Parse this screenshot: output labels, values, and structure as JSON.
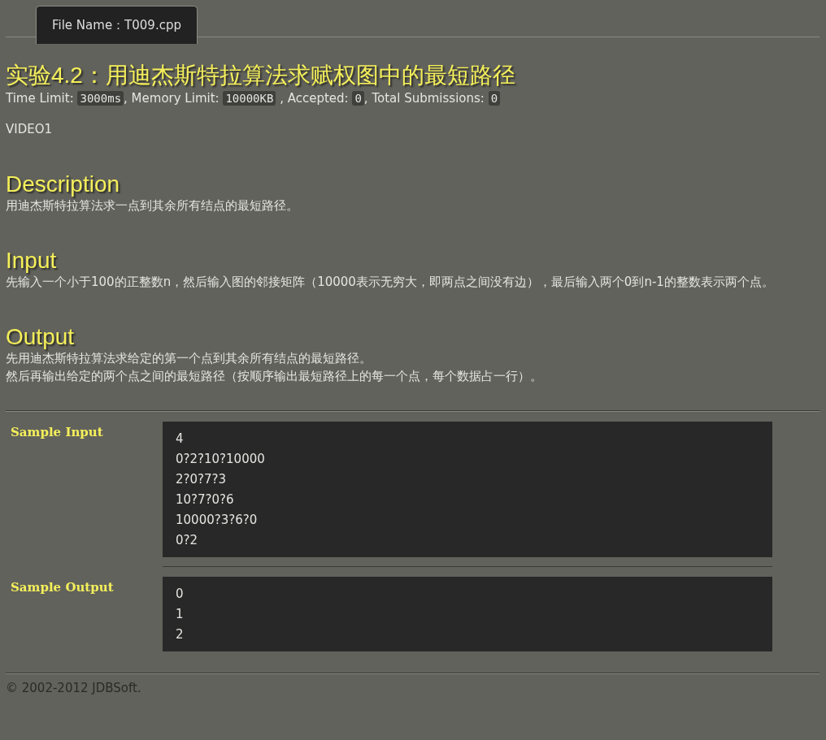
{
  "tab": {
    "label": "File Name：T009.cpp",
    "selected": true
  },
  "title": "实验4.2：用迪杰斯特拉算法求赋权图中的最短路径",
  "stats": [
    {
      "label": "Time Limit: ",
      "value": "3000ms"
    },
    {
      "label": ", Memory Limit: ",
      "value": "10000KB"
    },
    {
      "label": " , Accepted: ",
      "value": "0"
    },
    {
      "label": ", Total Submissions: ",
      "value": "0"
    }
  ],
  "note": "VIDEO1",
  "sections": [
    {
      "heading": "Description",
      "lines": [
        "用迪杰斯特拉算法求一点到其余所有结点的最短路径。"
      ]
    },
    {
      "heading": "Input",
      "lines": [
        "先输入一个小于100的正整数n，然后输入图的邻接矩阵（10000表示无穷大，即两点之间没有边），最后输入两个0到n-1的整数表示两个点。"
      ]
    },
    {
      "heading": "Output",
      "lines": [
        "先用迪杰斯特拉算法求给定的第一个点到其余所有结点的最短路径。",
        "然后再输出给定的两个点之间的最短路径（按顺序输出最短路径上的每一个点，每个数据占一行）。"
      ]
    }
  ],
  "samples": [
    {
      "label": "Sample Input",
      "lines": [
        "4",
        "0?2?10?10000",
        "2?0?7?3",
        "10?7?0?6",
        "10000?3?6?0",
        "0?2"
      ]
    },
    {
      "label": "Sample Output",
      "lines": [
        "0",
        "1",
        "2"
      ]
    }
  ],
  "footer": "© 2002-2012  JDBSoft."
}
